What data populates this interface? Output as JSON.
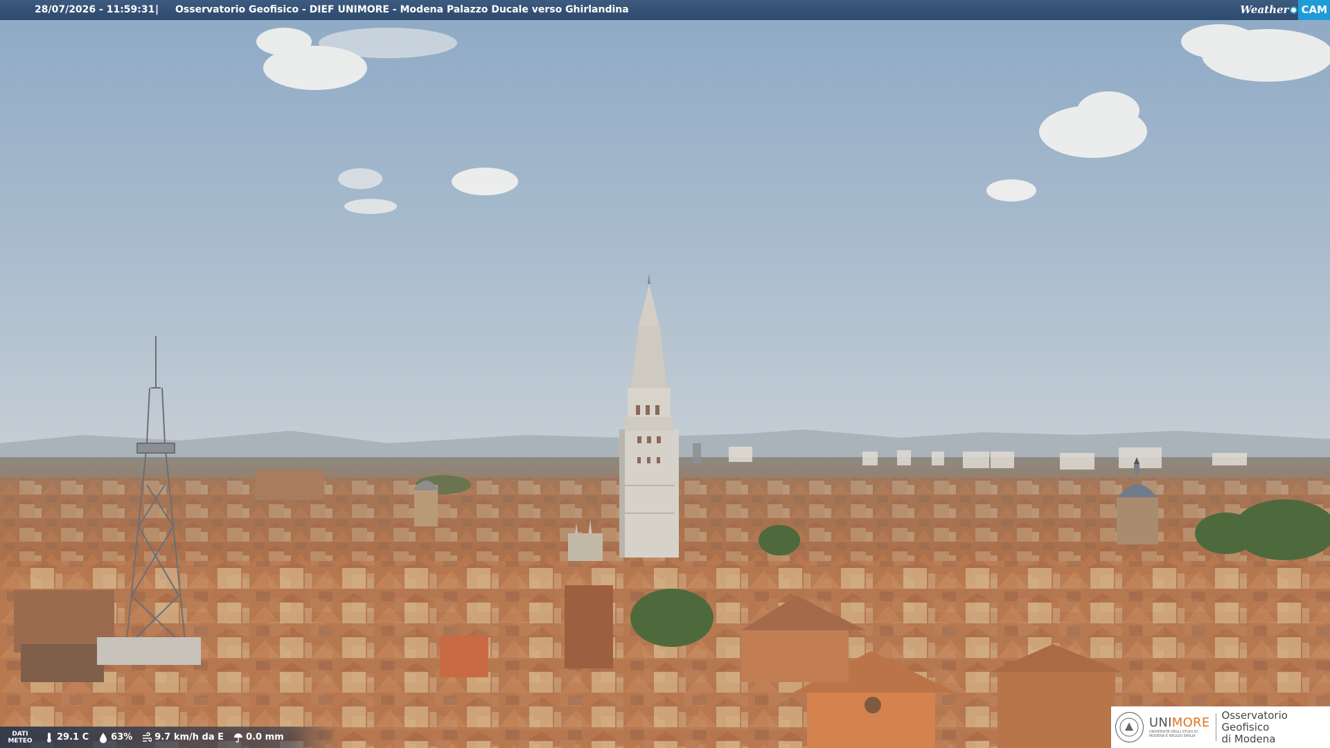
{
  "header": {
    "timestamp": "28/07/2026 - 11:59:31",
    "separator": "|",
    "title": "Osservatorio Geofisico - DIEF UNIMORE - Modena Palazzo Ducale verso Ghirlandina"
  },
  "brand": {
    "weather_word": "Weather",
    "cam_word": "CAM"
  },
  "weather": {
    "label_line1": "DATI",
    "label_line2": "METEO",
    "temperature": "29.1 C",
    "humidity": "63%",
    "wind": "9.7 km/h da E",
    "rain": "0.0 mm"
  },
  "logo": {
    "uni_prefix": "UNI",
    "uni_suffix": "MORE",
    "uni_subtitle_line1": "UNIVERSITÀ DEGLI STUDI DI",
    "uni_subtitle_line2": "MODENA E REGGIO EMILIA",
    "observatory_line1": "Osservatorio Geofisico",
    "observatory_line2": "di Modena"
  },
  "icons": {
    "temperature": "thermometer-icon",
    "humidity": "droplet-icon",
    "wind": "wind-icon",
    "rain": "umbrella-icon"
  },
  "colors": {
    "sky_top": "#8fa9c4",
    "sky_bottom": "#c2cdd6",
    "roof": "#b77a52",
    "tower": "#d6d2ca",
    "brand_blue": "#1e9cd7",
    "unimore_orange": "#e3731b"
  }
}
